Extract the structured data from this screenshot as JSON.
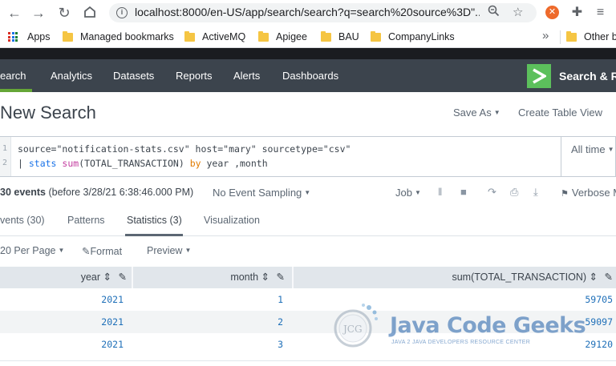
{
  "browser": {
    "url": "localhost:8000/en-US/app/search/search?q=search%20source%3D\"...",
    "bookmarks": [
      {
        "label": "Apps"
      },
      {
        "label": "Managed bookmarks"
      },
      {
        "label": "ActiveMQ"
      },
      {
        "label": "Apigee"
      },
      {
        "label": "BAU"
      },
      {
        "label": "CompanyLinks"
      }
    ],
    "overflow_chevron": "»",
    "other_bookmarks": "Other b"
  },
  "splunk_nav": {
    "items": [
      {
        "label": "earch"
      },
      {
        "label": "Analytics"
      },
      {
        "label": "Datasets"
      },
      {
        "label": "Reports"
      },
      {
        "label": "Alerts"
      },
      {
        "label": "Dashboards"
      }
    ],
    "brand_label": "Search & Re",
    "accent_color": "#65a637"
  },
  "search": {
    "title": "New Search",
    "save_as": "Save As",
    "create_table_view": "Create Table View",
    "time_picker": "All time",
    "query_line_1": {
      "ln": "1",
      "text": "source=\"notification-stats.csv\" host=\"mary\" sourcetype=\"csv\""
    },
    "query_line_2": {
      "ln": "2",
      "pipe": "| ",
      "cmd": "stats",
      "fn": "sum",
      "arg": "(TOTAL_TRANSACTION) ",
      "by": "by",
      "rest": " year ,month"
    }
  },
  "status": {
    "count": "30 events",
    "before": "(before 3/28/21 6:38:46.000 PM)",
    "sampling": "No Event Sampling",
    "job": "Job",
    "mode": "Verbose M"
  },
  "tabs": [
    {
      "label": "vents (30)"
    },
    {
      "label": "Patterns"
    },
    {
      "label": "Statistics (3)"
    },
    {
      "label": "Visualization"
    }
  ],
  "table_options": {
    "per_page": "20 Per Page",
    "format": "Format",
    "preview": "Preview"
  },
  "table": {
    "columns": [
      {
        "label": "year"
      },
      {
        "label": "month"
      },
      {
        "label": "sum(TOTAL_TRANSACTION)"
      }
    ],
    "rows": [
      {
        "year": "2021",
        "month": "1",
        "sum": "59705"
      },
      {
        "year": "2021",
        "month": "2",
        "sum": "59097"
      },
      {
        "year": "2021",
        "month": "3",
        "sum": "29120"
      }
    ]
  },
  "watermark": {
    "badge": "JCG",
    "title": "Java Code Geeks",
    "subtitle": "JAVA 2 JAVA DEVELOPERS RESOURCE CENTER"
  }
}
